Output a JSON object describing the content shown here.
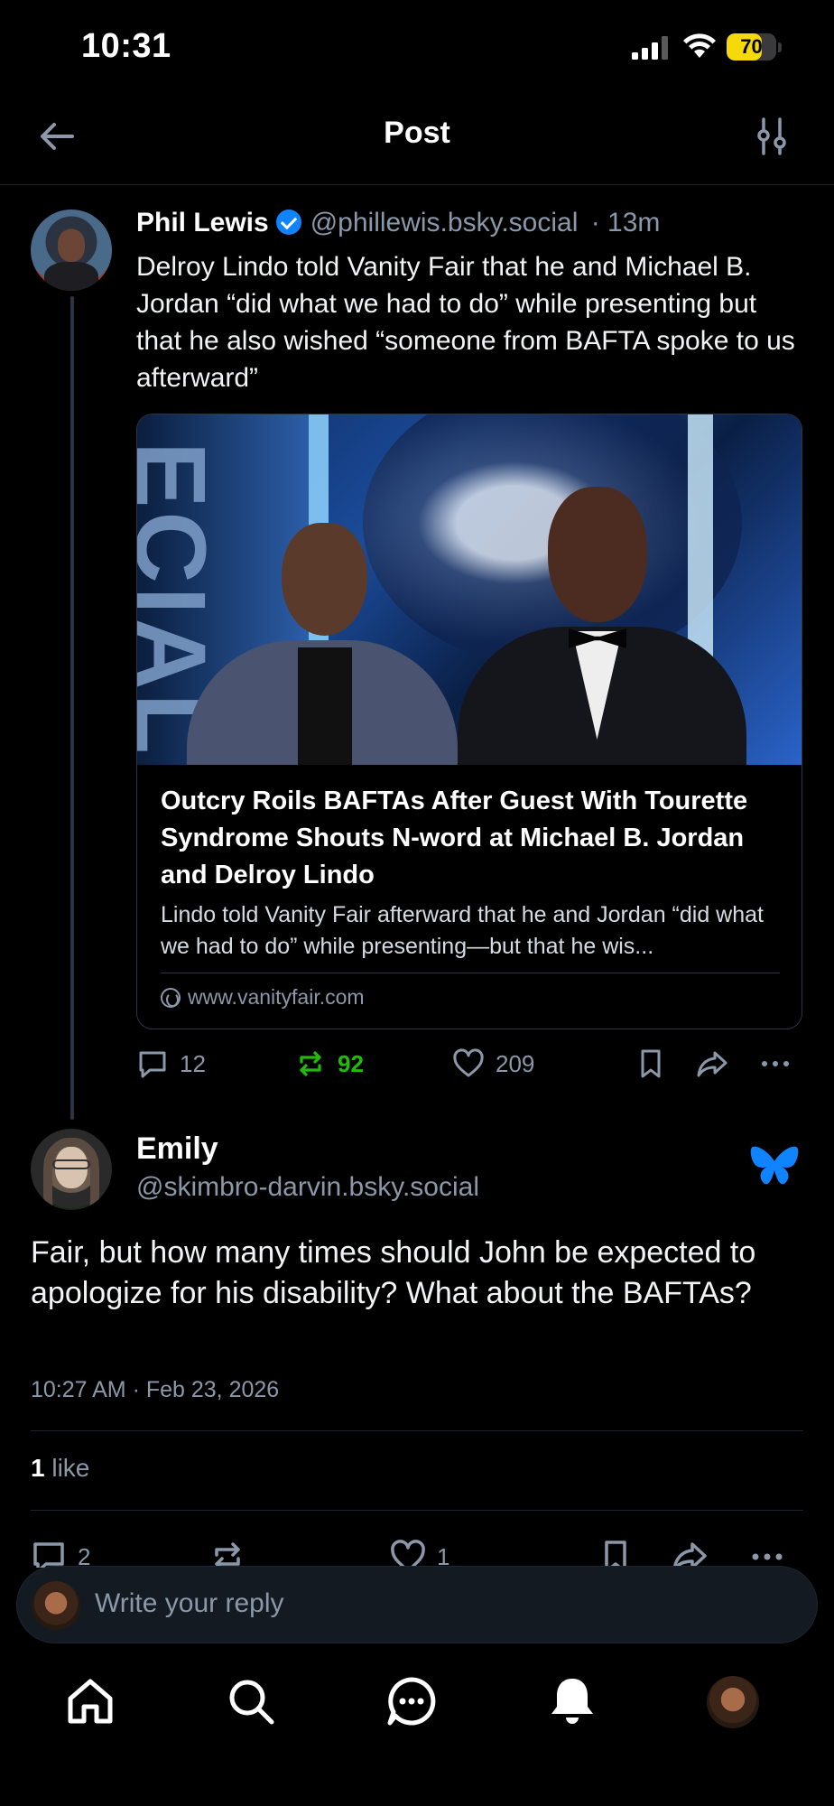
{
  "status_bar": {
    "time": "10:31",
    "battery_level": "70",
    "battery_fraction": 0.7
  },
  "header": {
    "title": "Post",
    "back_icon": "arrow-left-icon",
    "filter_icon": "sliders-icon"
  },
  "parent_post": {
    "author_name": "Phil Lewis",
    "handle": "@phillewis.bsky.social",
    "time_ago": "· 13m",
    "text": "Delroy Lindo told Vanity Fair that he and Michael B. Jordan “did what we had to do” while presenting but that he also wished “someone from BAFTA spoke to us afterward”",
    "link_card": {
      "title": "Outcry Roils BAFTAs After Guest With Tourette Syndrome Shouts N-word at Michael B. Jordan and Delroy Lindo",
      "description": "Lindo told Vanity Fair afterward that he and Jordan “did what we had to do” while presenting—but that he wis...",
      "domain": "www.vanityfair.com",
      "image_text": "ECIAL W"
    },
    "actions": {
      "replies": "12",
      "reposts": "92",
      "likes": "209"
    }
  },
  "main_post": {
    "author_name": "Emily",
    "handle": "@skimbro-darvin.bsky.social",
    "text": "Fair, but how many times should John be expected to apologize for his disability? What about the BAFTAs?",
    "timestamp": "10:27 AM · Feb 23, 2026",
    "likes_count": "1",
    "likes_label": " like",
    "actions": {
      "replies": "2",
      "likes": "1"
    }
  },
  "reply_bar": {
    "placeholder": "Write your reply"
  },
  "colors": {
    "accent": "#1083fe",
    "repost_green": "#20bc07",
    "muted": "#8b98a9",
    "background": "#000000"
  },
  "tabs": [
    "home-icon",
    "search-icon",
    "chat-icon",
    "bell-icon",
    "profile-avatar"
  ]
}
